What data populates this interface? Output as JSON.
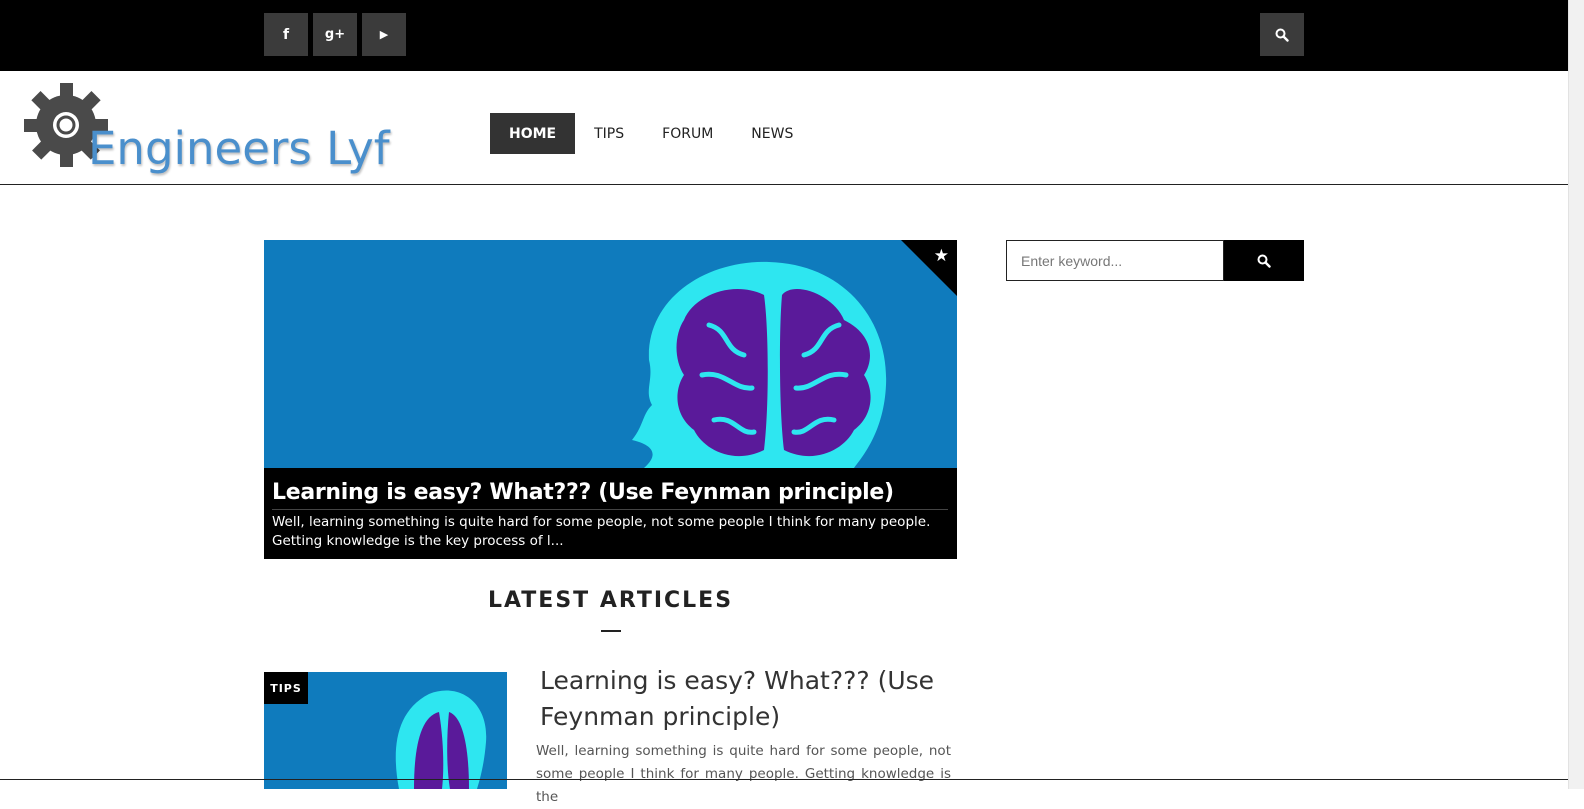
{
  "topbar": {
    "social": [
      {
        "icon": "facebook-icon",
        "glyph": "f"
      },
      {
        "icon": "google-plus-icon",
        "glyph": "g+"
      },
      {
        "icon": "youtube-icon",
        "glyph": "▶"
      }
    ],
    "search_icon": "search-icon"
  },
  "header": {
    "logo_text": "Engineers Lyf",
    "logo_icon": "gear-icon",
    "nav": [
      {
        "label": "HOME",
        "active": true
      },
      {
        "label": "TIPS",
        "active": false
      },
      {
        "label": "FORUM",
        "active": false
      },
      {
        "label": "NEWS",
        "active": false
      }
    ]
  },
  "featured": {
    "title": "Learning is easy? What??? (Use Feynman principle)",
    "excerpt": "Well, learning something is quite hard for some people, not some people I think for many people. Getting knowledge is the key process of l...",
    "badge_icon": "star-icon",
    "image_bg": "#0f7bbd",
    "head_color": "#2ee6f0",
    "brain_color": "#5a1a9a"
  },
  "sidebar": {
    "search_placeholder": "Enter keyword...",
    "search_value": ""
  },
  "latest": {
    "heading": "LATEST ARTICLES",
    "articles": [
      {
        "category": "TIPS",
        "title": "Learning is easy? What??? (Use Feynman principle)",
        "excerpt": "Well, learning something is quite hard for some people, not some people I think for many people. Getting knowledge is the"
      }
    ]
  }
}
